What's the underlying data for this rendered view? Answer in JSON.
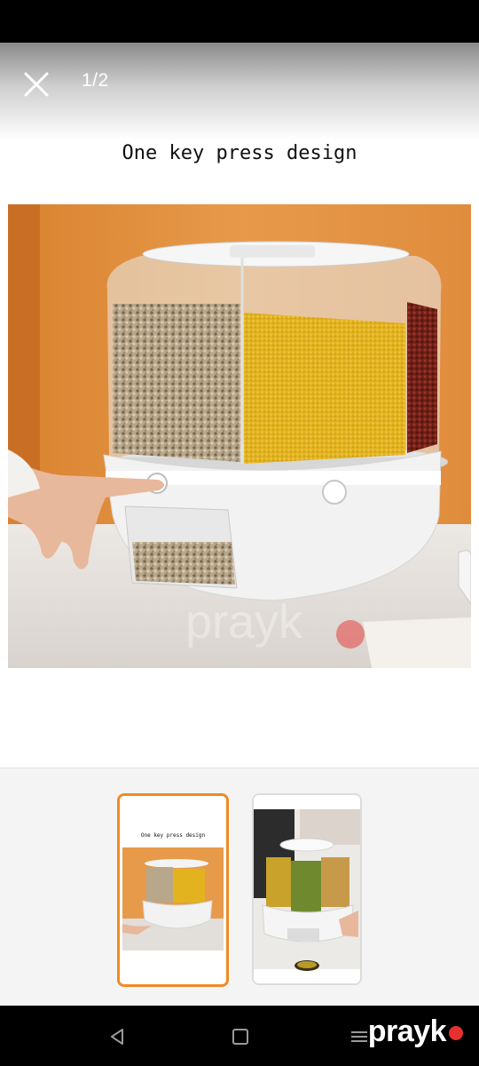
{
  "viewer": {
    "counter": "1/2",
    "caption": "One key press design"
  },
  "thumbnails": [
    {
      "caption": "One key press design",
      "selected": true
    },
    {
      "caption": "",
      "selected": false
    }
  ],
  "watermark": {
    "text": "prayk",
    "dot_color": "#e5312f"
  },
  "colors": {
    "accent_border": "#f08a24",
    "wall_orange": "#e79a4a",
    "product_white": "#f2f2f2"
  }
}
